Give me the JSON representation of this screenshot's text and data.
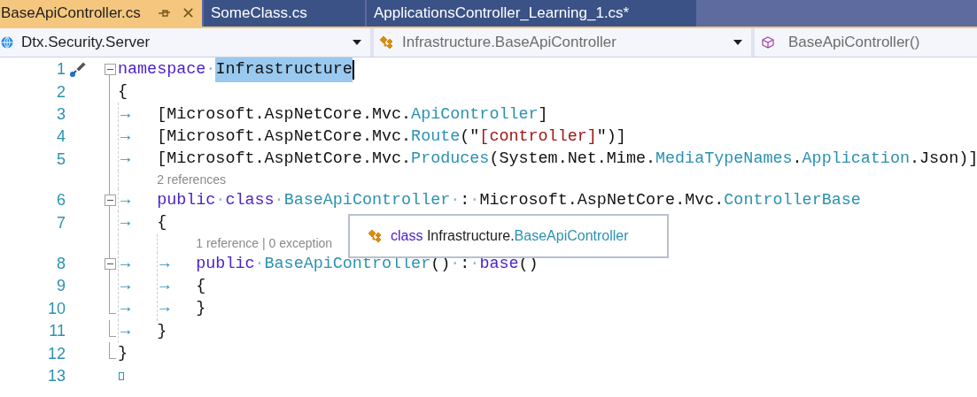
{
  "tabs": [
    {
      "label": "BaseApiController.cs",
      "selected": true,
      "pinned": true
    },
    {
      "label": "SomeClass.cs",
      "selected": false,
      "pinned": false
    },
    {
      "label": "ApplicationsController_Learning_1.cs*",
      "selected": false,
      "pinned": false
    }
  ],
  "tab_close": "✕",
  "navigation": [
    {
      "kind": "project",
      "label": "Dtx.Security.Server"
    },
    {
      "kind": "class",
      "label": "Infrastructure.BaseApiController"
    },
    {
      "kind": "method",
      "label": "BaseApiController()"
    }
  ],
  "lines": [
    {
      "kind": "code",
      "number": "1",
      "fold": {
        "kind": "start",
        "expanded": true
      },
      "quick_actions": true,
      "tokens": [
        {
          "kind": "keyword",
          "text": "namespace"
        },
        {
          "kind": "ws",
          "text": "·"
        },
        {
          "kind": "plain",
          "text": "Infrastructure",
          "selected": true
        }
      ]
    },
    {
      "kind": "code",
      "number": "2",
      "fold": {
        "kind": "mid"
      },
      "tokens": [
        {
          "kind": "plain",
          "text": "{"
        }
      ]
    },
    {
      "kind": "code",
      "number": "3",
      "fold": {
        "kind": "mid"
      },
      "tokens": [
        {
          "kind": "tab",
          "text": "→"
        },
        {
          "kind": "plain",
          "text": "[Microsoft.AspNetCore.Mvc."
        },
        {
          "kind": "type",
          "text": "ApiController"
        },
        {
          "kind": "plain",
          "text": "]"
        }
      ]
    },
    {
      "kind": "code",
      "number": "4",
      "fold": {
        "kind": "mid"
      },
      "tokens": [
        {
          "kind": "tab",
          "text": "→"
        },
        {
          "kind": "plain",
          "text": "[Microsoft.AspNetCore.Mvc."
        },
        {
          "kind": "type",
          "text": "Route"
        },
        {
          "kind": "plain",
          "text": "(\""
        },
        {
          "kind": "string",
          "text": "[controller]"
        },
        {
          "kind": "plain",
          "text": "\")]"
        }
      ]
    },
    {
      "kind": "code",
      "number": "5",
      "fold": {
        "kind": "mid"
      },
      "tokens": [
        {
          "kind": "tab",
          "text": "→"
        },
        {
          "kind": "plain",
          "text": "[Microsoft.AspNetCore.Mvc."
        },
        {
          "kind": "type",
          "text": "Produces"
        },
        {
          "kind": "plain",
          "text": "(System.Net.Mime."
        },
        {
          "kind": "type",
          "text": "MediaTypeNames"
        },
        {
          "kind": "plain",
          "text": "."
        },
        {
          "kind": "type",
          "text": "Application"
        },
        {
          "kind": "plain",
          "text": ".Json)]"
        }
      ]
    },
    {
      "kind": "lens",
      "fold": {
        "kind": "mid"
      },
      "indent": [
        {
          "kind": "guide"
        }
      ],
      "text": "2 references"
    },
    {
      "kind": "code",
      "number": "6",
      "fold": {
        "kind": "start",
        "expanded": true
      },
      "tokens": [
        {
          "kind": "tab",
          "text": "→"
        },
        {
          "kind": "keyword",
          "text": "public"
        },
        {
          "kind": "ws",
          "text": "·"
        },
        {
          "kind": "keyword",
          "text": "class"
        },
        {
          "kind": "ws",
          "text": "·"
        },
        {
          "kind": "type",
          "text": "BaseApiController"
        },
        {
          "kind": "ws",
          "text": "·"
        },
        {
          "kind": "plain",
          "text": ":"
        },
        {
          "kind": "ws",
          "text": "·"
        },
        {
          "kind": "plain",
          "text": "Microsoft.AspNetCore.Mvc."
        },
        {
          "kind": "type",
          "text": "ControllerBase"
        }
      ]
    },
    {
      "kind": "code",
      "number": "7",
      "fold": {
        "kind": "mid"
      },
      "tokens": [
        {
          "kind": "tab",
          "text": "→"
        },
        {
          "kind": "plain",
          "text": "{"
        }
      ]
    },
    {
      "kind": "lens",
      "fold": {
        "kind": "mid"
      },
      "indent": [
        {
          "kind": "guide"
        },
        {
          "kind": "guide"
        }
      ],
      "text": "1 reference | 0 exception"
    },
    {
      "kind": "code",
      "number": "8",
      "fold": {
        "kind": "start",
        "expanded": true
      },
      "tokens": [
        {
          "kind": "tab",
          "text": "→"
        },
        {
          "kind": "tab",
          "text": "→"
        },
        {
          "kind": "keyword",
          "text": "public"
        },
        {
          "kind": "ws",
          "text": "·"
        },
        {
          "kind": "type",
          "text": "BaseApiController"
        },
        {
          "kind": "plain",
          "text": "()"
        },
        {
          "kind": "ws",
          "text": "·"
        },
        {
          "kind": "plain",
          "text": ":"
        },
        {
          "kind": "ws",
          "text": "·"
        },
        {
          "kind": "keyword",
          "text": "base"
        },
        {
          "kind": "plain",
          "text": "()"
        }
      ]
    },
    {
      "kind": "code",
      "number": "9",
      "fold": {
        "kind": "mid"
      },
      "tokens": [
        {
          "kind": "tab",
          "text": "→"
        },
        {
          "kind": "tab",
          "text": "→"
        },
        {
          "kind": "plain",
          "text": "{"
        }
      ]
    },
    {
      "kind": "code",
      "number": "10",
      "fold": {
        "kind": "end"
      },
      "tokens": [
        {
          "kind": "tab",
          "text": "→"
        },
        {
          "kind": "tab",
          "text": "→"
        },
        {
          "kind": "plain",
          "text": "}"
        }
      ]
    },
    {
      "kind": "code",
      "number": "11",
      "fold": {
        "kind": "end"
      },
      "tokens": [
        {
          "kind": "tab",
          "text": "→"
        },
        {
          "kind": "plain",
          "text": "}"
        }
      ]
    },
    {
      "kind": "code",
      "number": "12",
      "fold": {
        "kind": "end"
      },
      "tokens": [
        {
          "kind": "plain",
          "text": "}"
        }
      ]
    },
    {
      "kind": "end",
      "number": "13",
      "fold": {
        "kind": "none"
      }
    }
  ],
  "tooltip": {
    "keyword": "class",
    "namespace": "Infrastructure.",
    "name": "BaseApiController"
  }
}
